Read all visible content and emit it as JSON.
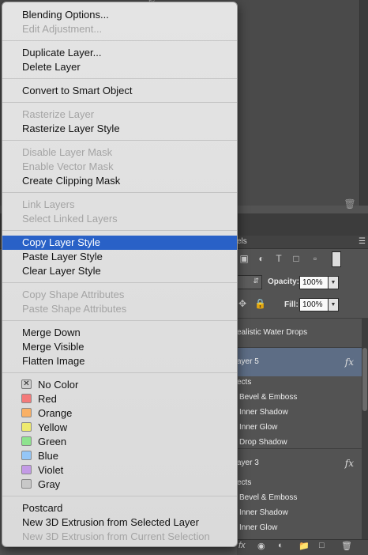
{
  "background": {
    "panel_tab_fragment": "els",
    "blend_mode_fragment": "",
    "opacity_label": "Opacity:",
    "opacity_value": "100%",
    "fill_label": "Fill:",
    "fill_value": "100%",
    "layers": [
      {
        "name": "ealistic  Water Drops",
        "type": "text"
      },
      {
        "name": "ayer 5",
        "type": "layer",
        "selected": true,
        "fx": "fx"
      },
      {
        "name": "ects",
        "type": "effects-header"
      },
      {
        "name": "Bevel & Emboss",
        "type": "effect"
      },
      {
        "name": "Inner Shadow",
        "type": "effect"
      },
      {
        "name": "Inner Glow",
        "type": "effect"
      },
      {
        "name": "Drop Shadow",
        "type": "effect"
      },
      {
        "name": "ayer 3",
        "type": "layer",
        "fx": "fx"
      },
      {
        "name": "ects",
        "type": "effects-header"
      },
      {
        "name": "Bevel & Emboss",
        "type": "effect"
      },
      {
        "name": "Inner Shadow",
        "type": "effect"
      },
      {
        "name": "Inner Glow",
        "type": "effect"
      }
    ]
  },
  "menu": {
    "groups": [
      {
        "items": [
          {
            "label": "Blending Options...",
            "enabled": true
          },
          {
            "label": "Edit Adjustment...",
            "enabled": false
          }
        ]
      },
      {
        "items": [
          {
            "label": "Duplicate Layer...",
            "enabled": true
          },
          {
            "label": "Delete Layer",
            "enabled": true
          }
        ]
      },
      {
        "items": [
          {
            "label": "Convert to Smart Object",
            "enabled": true
          }
        ]
      },
      {
        "items": [
          {
            "label": "Rasterize Layer",
            "enabled": false
          },
          {
            "label": "Rasterize Layer Style",
            "enabled": true
          }
        ]
      },
      {
        "items": [
          {
            "label": "Disable Layer Mask",
            "enabled": false
          },
          {
            "label": "Enable Vector Mask",
            "enabled": false
          },
          {
            "label": "Create Clipping Mask",
            "enabled": true
          }
        ]
      },
      {
        "items": [
          {
            "label": "Link Layers",
            "enabled": false
          },
          {
            "label": "Select Linked Layers",
            "enabled": false
          }
        ]
      },
      {
        "items": [
          {
            "label": "Copy Layer Style",
            "enabled": true,
            "highlighted": true
          },
          {
            "label": "Paste Layer Style",
            "enabled": true
          },
          {
            "label": "Clear Layer Style",
            "enabled": true
          }
        ]
      },
      {
        "items": [
          {
            "label": "Copy Shape Attributes",
            "enabled": false
          },
          {
            "label": "Paste Shape Attributes",
            "enabled": false
          }
        ]
      },
      {
        "items": [
          {
            "label": "Merge Down",
            "enabled": true
          },
          {
            "label": "Merge Visible",
            "enabled": true
          },
          {
            "label": "Flatten Image",
            "enabled": true
          }
        ]
      },
      {
        "items": [
          {
            "label": "No Color",
            "enabled": true,
            "color": "none"
          },
          {
            "label": "Red",
            "enabled": true,
            "color": "#f47a7a"
          },
          {
            "label": "Orange",
            "enabled": true,
            "color": "#f9b065"
          },
          {
            "label": "Yellow",
            "enabled": true,
            "color": "#eeea6f"
          },
          {
            "label": "Green",
            "enabled": true,
            "color": "#8fe38f"
          },
          {
            "label": "Blue",
            "enabled": true,
            "color": "#94c6f7"
          },
          {
            "label": "Violet",
            "enabled": true,
            "color": "#c39ae6"
          },
          {
            "label": "Gray",
            "enabled": true,
            "color": "#c8c8c8"
          }
        ]
      },
      {
        "items": [
          {
            "label": "Postcard",
            "enabled": true
          },
          {
            "label": "New 3D Extrusion from Selected Layer",
            "enabled": true
          },
          {
            "label": "New 3D Extrusion from Current Selection",
            "enabled": false
          }
        ]
      }
    ]
  },
  "colors": {
    "menu_highlight": "#2961c7",
    "selected_layer_row": "#5d6d85",
    "panel_background": "#535353"
  }
}
